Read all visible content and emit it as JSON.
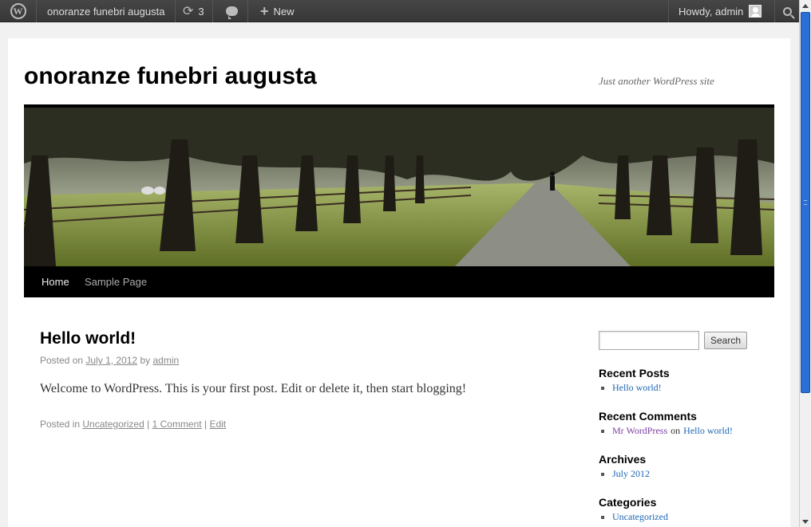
{
  "adminbar": {
    "site_name": "onoranze funebri augusta",
    "updates_count": "3",
    "new_label": "New",
    "howdy": "Howdy, admin"
  },
  "site": {
    "title": "onoranze funebri augusta",
    "description": "Just another WordPress site"
  },
  "menu": {
    "items": [
      {
        "label": "Home"
      },
      {
        "label": "Sample Page"
      }
    ]
  },
  "post": {
    "title": "Hello world!",
    "posted_on": "Posted on",
    "date": "July 1, 2012",
    "by": "by",
    "author": "admin",
    "content": "Welcome to WordPress. This is your first post. Edit or delete it, then start blogging!",
    "posted_in": "Posted in",
    "category": "Uncategorized",
    "sep": "|",
    "comments": "1 Comment",
    "edit": "Edit"
  },
  "sidebar": {
    "search_button": "Search",
    "recent_posts_title": "Recent Posts",
    "recent_posts": [
      "Hello world!"
    ],
    "recent_comments_title": "Recent Comments",
    "recent_comment": {
      "author": "Mr WordPress",
      "on": "on",
      "post": "Hello world!"
    },
    "archives_title": "Archives",
    "archives": [
      "July 2012"
    ],
    "categories_title": "Categories",
    "categories": [
      "Uncategorized"
    ]
  },
  "colors": {
    "adminbar_bg": "#464646",
    "link": "#1b64b3",
    "comment_author": "#7b3f9e",
    "scroll_thumb": "#2b6fd6"
  },
  "icons": [
    "wordpress-logo-icon",
    "updates-icon",
    "comment-bubble-icon",
    "plus-icon",
    "avatar-icon",
    "search-icon"
  ]
}
